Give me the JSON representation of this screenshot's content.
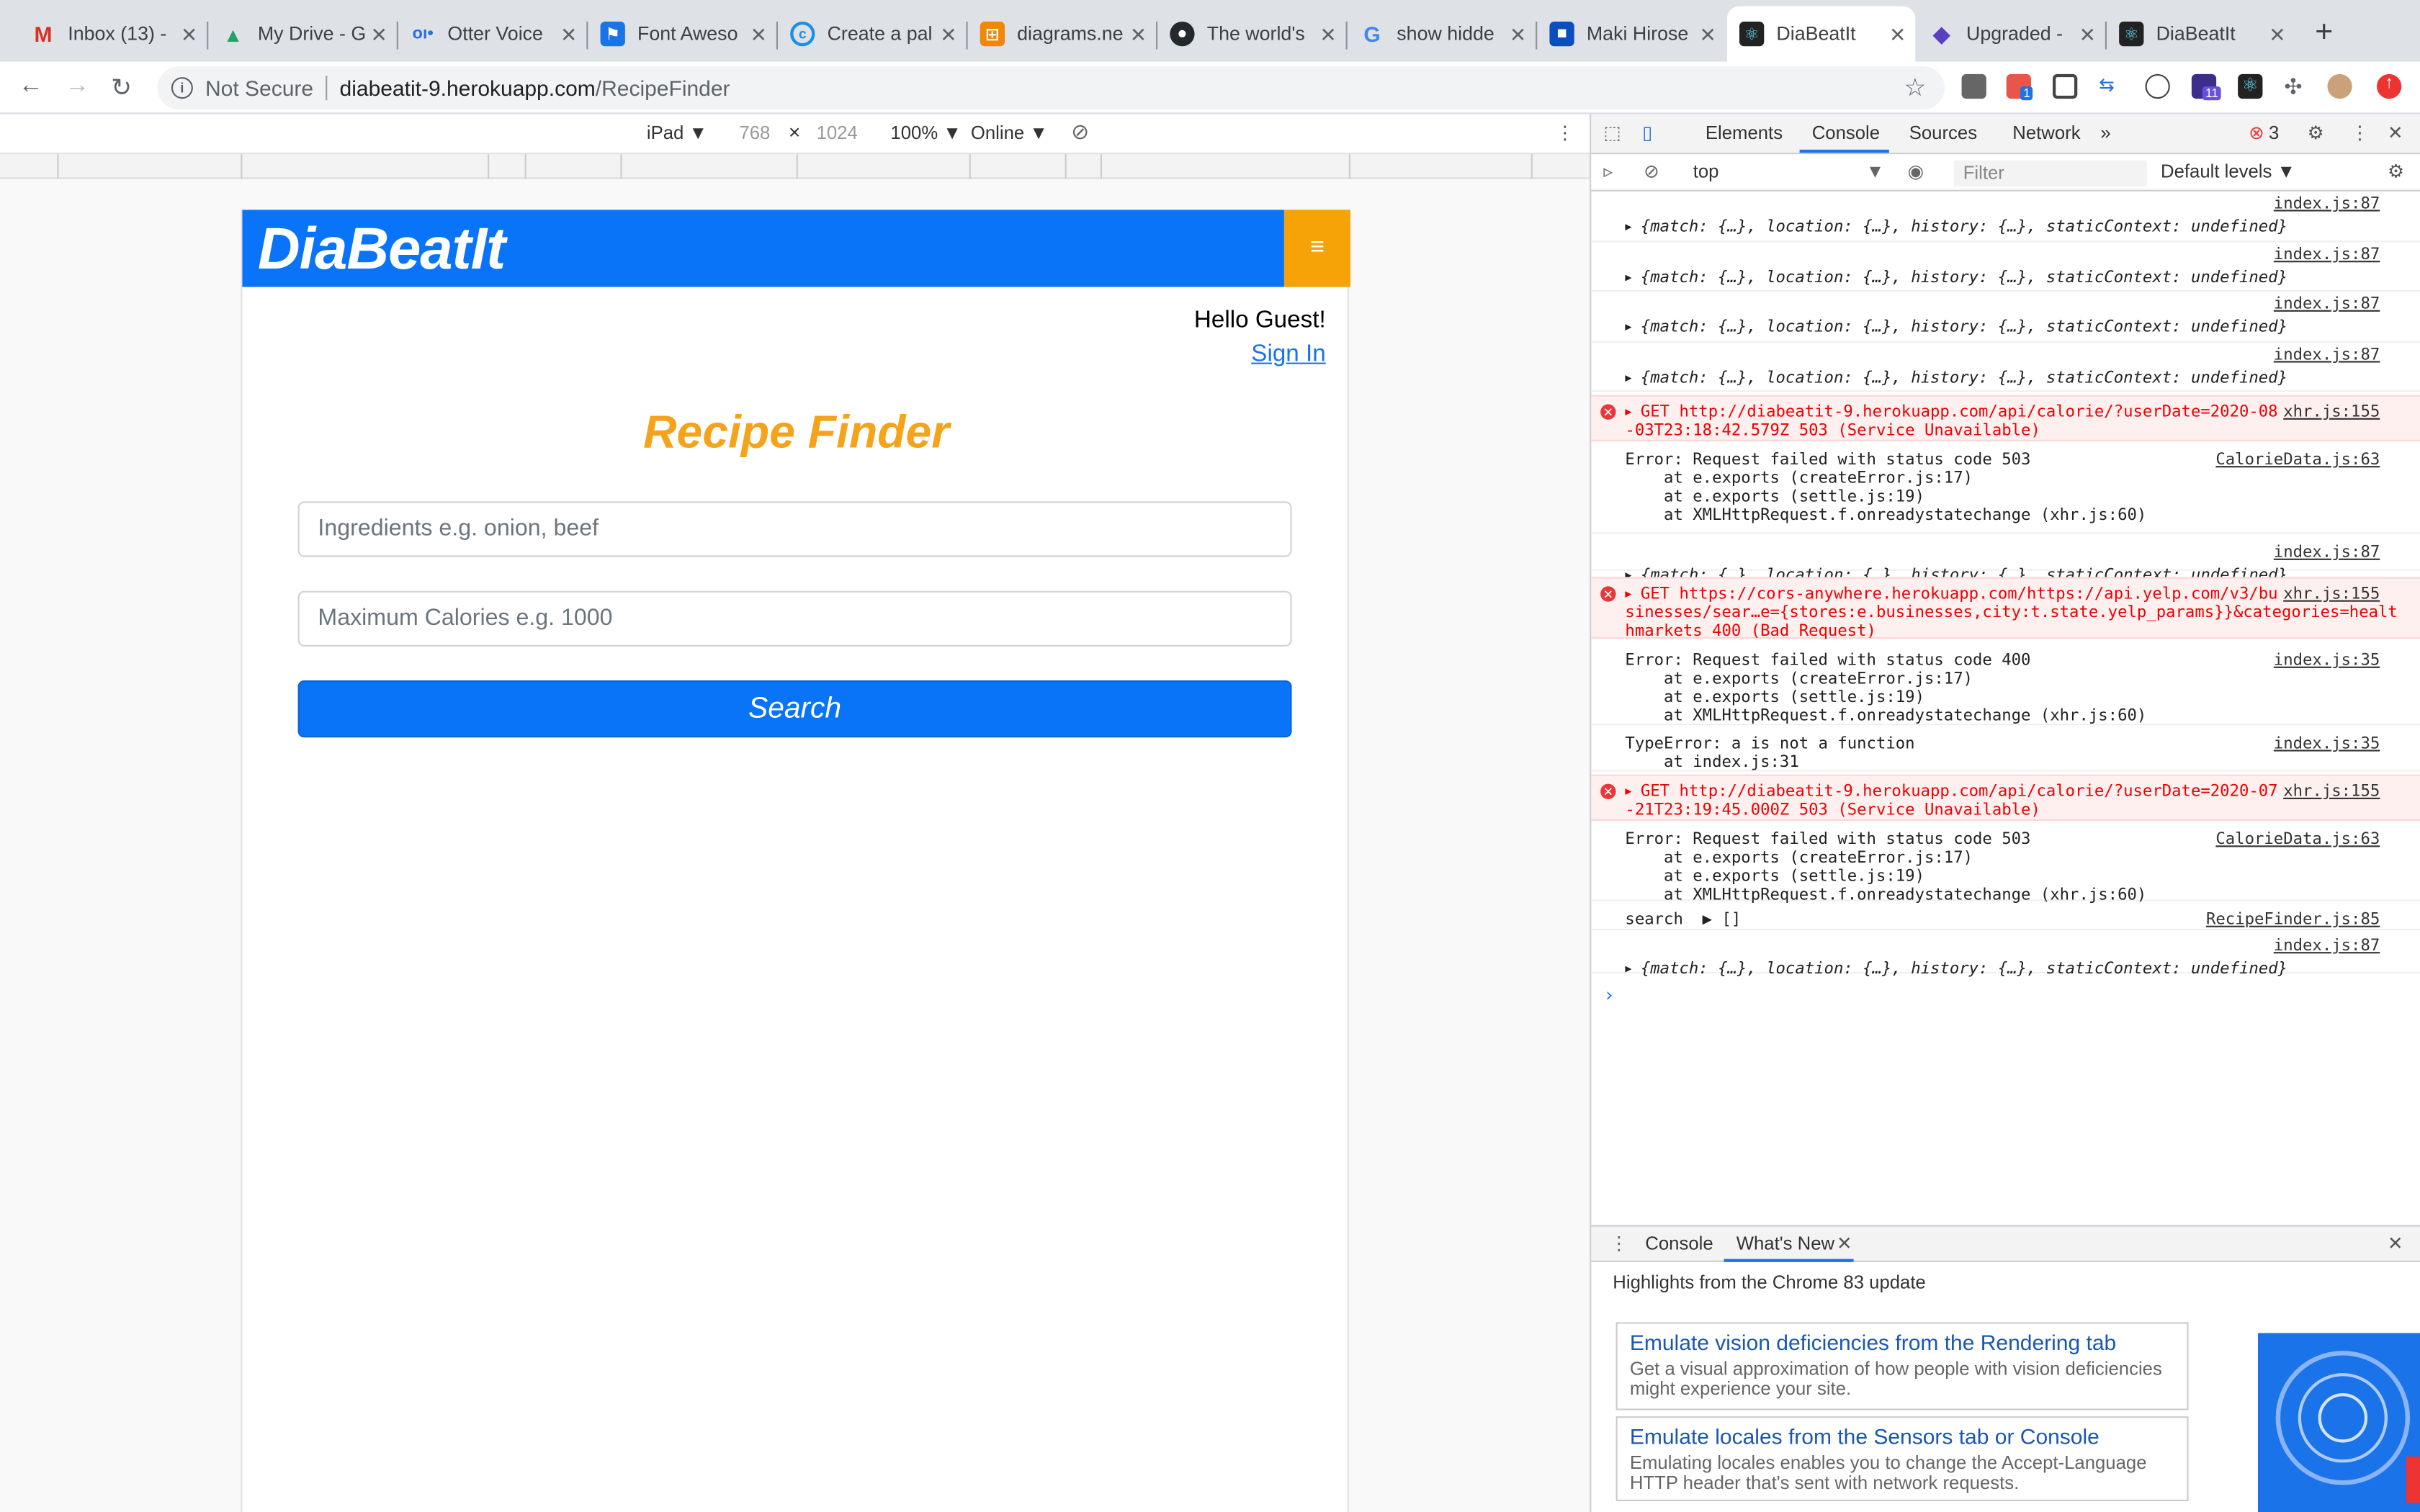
{
  "browser": {
    "tabs": [
      {
        "title": "Inbox (13) -",
        "favicon": "gmail-icon",
        "color": "#d93025"
      },
      {
        "title": "My Drive - G",
        "favicon": "drive-icon",
        "color": "#1fa463"
      },
      {
        "title": "Otter Voice",
        "favicon": "otter-icon",
        "color": "#2a6fdb"
      },
      {
        "title": "Font Aweso",
        "favicon": "fontawesome-icon",
        "color": "#1a73e8"
      },
      {
        "title": "Create a pal",
        "favicon": "create-icon",
        "color": "#1a8fe8"
      },
      {
        "title": "diagrams.ne",
        "favicon": "diagrams-icon",
        "color": "#f08705"
      },
      {
        "title": "The world's",
        "favicon": "github-icon",
        "color": "#24292e"
      },
      {
        "title": "show hidde",
        "favicon": "google-icon",
        "color": "#4285f4"
      },
      {
        "title": "Maki Hirose",
        "favicon": "maki-icon",
        "color": "#0b4fbf"
      },
      {
        "title": "DiaBeatIt",
        "favicon": "react-icon",
        "color": "#222222"
      },
      {
        "title": "Upgraded -",
        "favicon": "upgraded-icon",
        "color": "#5a3fc0"
      },
      {
        "title": "DiaBeatIt",
        "favicon": "react-icon",
        "color": "#222222"
      }
    ],
    "url_security": "Not Secure",
    "url_host": "diabeatit-9.herokuapp.com",
    "url_path": "/RecipeFinder",
    "ext_badges": {
      "one": "1",
      "eleven": "11"
    }
  },
  "device_toolbar": {
    "device": "iPad ▼",
    "width": "768",
    "times": "×",
    "height": "1024",
    "zoom": "100% ▼",
    "network": "Online ▼"
  },
  "app": {
    "brand": "DiaBeatIt",
    "menu_glyph": "≡",
    "greeting": "Hello Guest!",
    "sign_in": "Sign In",
    "title": "Recipe Finder",
    "ingredients_placeholder": "Ingredients e.g. onion, beef",
    "calories_placeholder": "Maximum Calories e.g. 1000",
    "search_label": "Search"
  },
  "devtools": {
    "tabs": [
      "Elements",
      "Console",
      "Sources",
      "Network"
    ],
    "more": "»",
    "error_count": "3",
    "context": "top",
    "filter_placeholder": "Filter",
    "levels": "Default levels ▼",
    "console_rows": [
      {
        "src": "index.js:87",
        "lines": [
          "{match: {…}, location: {…}, history: {…}, staticContext: undefined}"
        ]
      },
      {
        "src": "index.js:87",
        "lines": [
          "{match: {…}, location: {…}, history: {…}, staticContext: undefined}"
        ]
      },
      {
        "src": "index.js:87",
        "lines": [
          "{match: {…}, location: {…}, history: {…}, staticContext: undefined}"
        ]
      },
      {
        "src": "index.js:87",
        "lines": [
          "{match: {…}, location: {…}, history: {…}, staticContext: undefined}"
        ]
      },
      {
        "src": "xhr.js:155",
        "lines": [
          "GET http://diabeatit-9.herokuapp.com/api/calorie/?userDate=2020-08",
          "-03T23:18:42.579Z 503 (Service Unavailable)"
        ]
      },
      {
        "src": "CalorieData.js:63",
        "lines": [
          "Error: Request failed with status code 503",
          "    at e.exports (createError.js:17)",
          "    at e.exports (settle.js:19)",
          "    at XMLHttpRequest.f.onreadystatechange (xhr.js:60)"
        ]
      },
      {
        "src": "index.js:87",
        "lines": [
          "{match: {…}, location: {…}, history: {…}, staticContext: undefined}"
        ]
      },
      {
        "src": "xhr.js:155",
        "lines": [
          "GET https://cors-anywhere.herokuapp.com/https://api.yelp.com/v3/bu",
          "sinesses/sear…e={stores:e.businesses,city:t.state.yelp_params}}&categories=healt",
          "hmarkets 400 (Bad Request)"
        ]
      },
      {
        "src": "index.js:35",
        "lines": [
          "Error: Request failed with status code 400",
          "    at e.exports (createError.js:17)",
          "    at e.exports (settle.js:19)",
          "    at XMLHttpRequest.f.onreadystatechange (xhr.js:60)"
        ]
      },
      {
        "src": "index.js:35",
        "lines": [
          "TypeError: a is not a function",
          "    at index.js:31"
        ]
      },
      {
        "src": "xhr.js:155",
        "lines": [
          "GET http://diabeatit-9.herokuapp.com/api/calorie/?userDate=2020-07",
          "-21T23:19:45.000Z 503 (Service Unavailable)"
        ]
      },
      {
        "src": "CalorieData.js:63",
        "lines": [
          "Error: Request failed with status code 503",
          "    at e.exports (createError.js:17)",
          "    at e.exports (settle.js:19)",
          "    at XMLHttpRequest.f.onreadystatechange (xhr.js:60)"
        ]
      },
      {
        "src": "RecipeFinder.js:85",
        "lines": [
          "search  ▶ []"
        ]
      },
      {
        "src": "index.js:87",
        "lines": [
          "{match: {…}, location: {…}, history: {…}, staticContext: undefined}"
        ]
      }
    ],
    "prompt": "›",
    "drawer_tabs": [
      "Console",
      "What's New"
    ],
    "highlights": "Highlights from the Chrome 83 update",
    "cards": [
      {
        "title": "Emulate vision deficiencies from the Rendering tab",
        "desc_1": "Get a visual approximation of how people with vision deficiencies",
        "desc_2": "might experience your site."
      },
      {
        "title": "Emulate locales from the Sensors tab or Console",
        "desc_1": "Emulating locales enables you to change the Accept-Language",
        "desc_2": "HTTP header that's sent with network requests."
      }
    ]
  }
}
